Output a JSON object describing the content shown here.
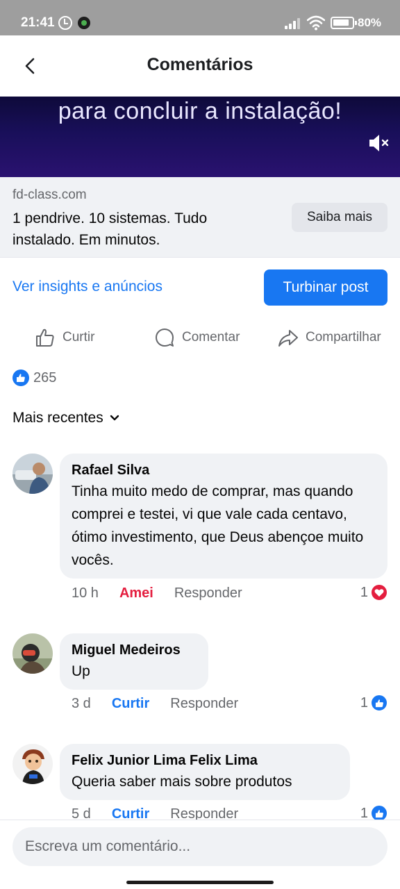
{
  "status_bar": {
    "time": "21:41",
    "battery": "80%",
    "icons": [
      "alarm-icon",
      "app-notification-icon",
      "signal-icon",
      "wifi-icon",
      "battery-icon"
    ]
  },
  "header": {
    "title": "Comentários",
    "back_icon": "chevron-left-icon"
  },
  "video": {
    "caption": "para concluir a instalação!",
    "mute_icon": "volume-muted-icon"
  },
  "link_preview": {
    "domain": "fd-class.com",
    "title": "1 pendrive. 10 sistemas. Tudo instalado. Em minutos.",
    "cta": "Saiba mais"
  },
  "promo": {
    "insights_label": "Ver insights e anúncios",
    "boost_label": "Turbinar post"
  },
  "actions": {
    "like": "Curtir",
    "comment": "Comentar",
    "share": "Compartilhar"
  },
  "reactions": {
    "count": "265"
  },
  "sort": {
    "label": "Mais recentes"
  },
  "comments": [
    {
      "name": "Rafael Silva",
      "text": "Tinha muito medo de comprar, mas quando comprei e testei, vi que vale cada centavo, ótimo investimento, que Deus abençoe muito vocês.",
      "time": "10 h",
      "reaction_label": "Amei",
      "reply_label": "Responder",
      "reaction_count": "1",
      "reaction_type": "love"
    },
    {
      "name": "Miguel Medeiros",
      "text": "Up",
      "time": "3 d",
      "reaction_label": "Curtir",
      "reply_label": "Responder",
      "reaction_count": "1",
      "reaction_type": "like"
    },
    {
      "name": "Felix Junior Lima Felix Lima",
      "text": "Queria saber mais sobre produtos",
      "time": "5 d",
      "reaction_label": "Curtir",
      "reply_label": "Responder",
      "reaction_count": "1",
      "reaction_type": "like"
    }
  ],
  "composer": {
    "placeholder": "Escreva um comentário..."
  },
  "colors": {
    "brand_blue": "#1877f2",
    "love_red": "#e41e3f",
    "bubble_gray": "#f0f2f5",
    "secondary_text": "#65676b"
  }
}
